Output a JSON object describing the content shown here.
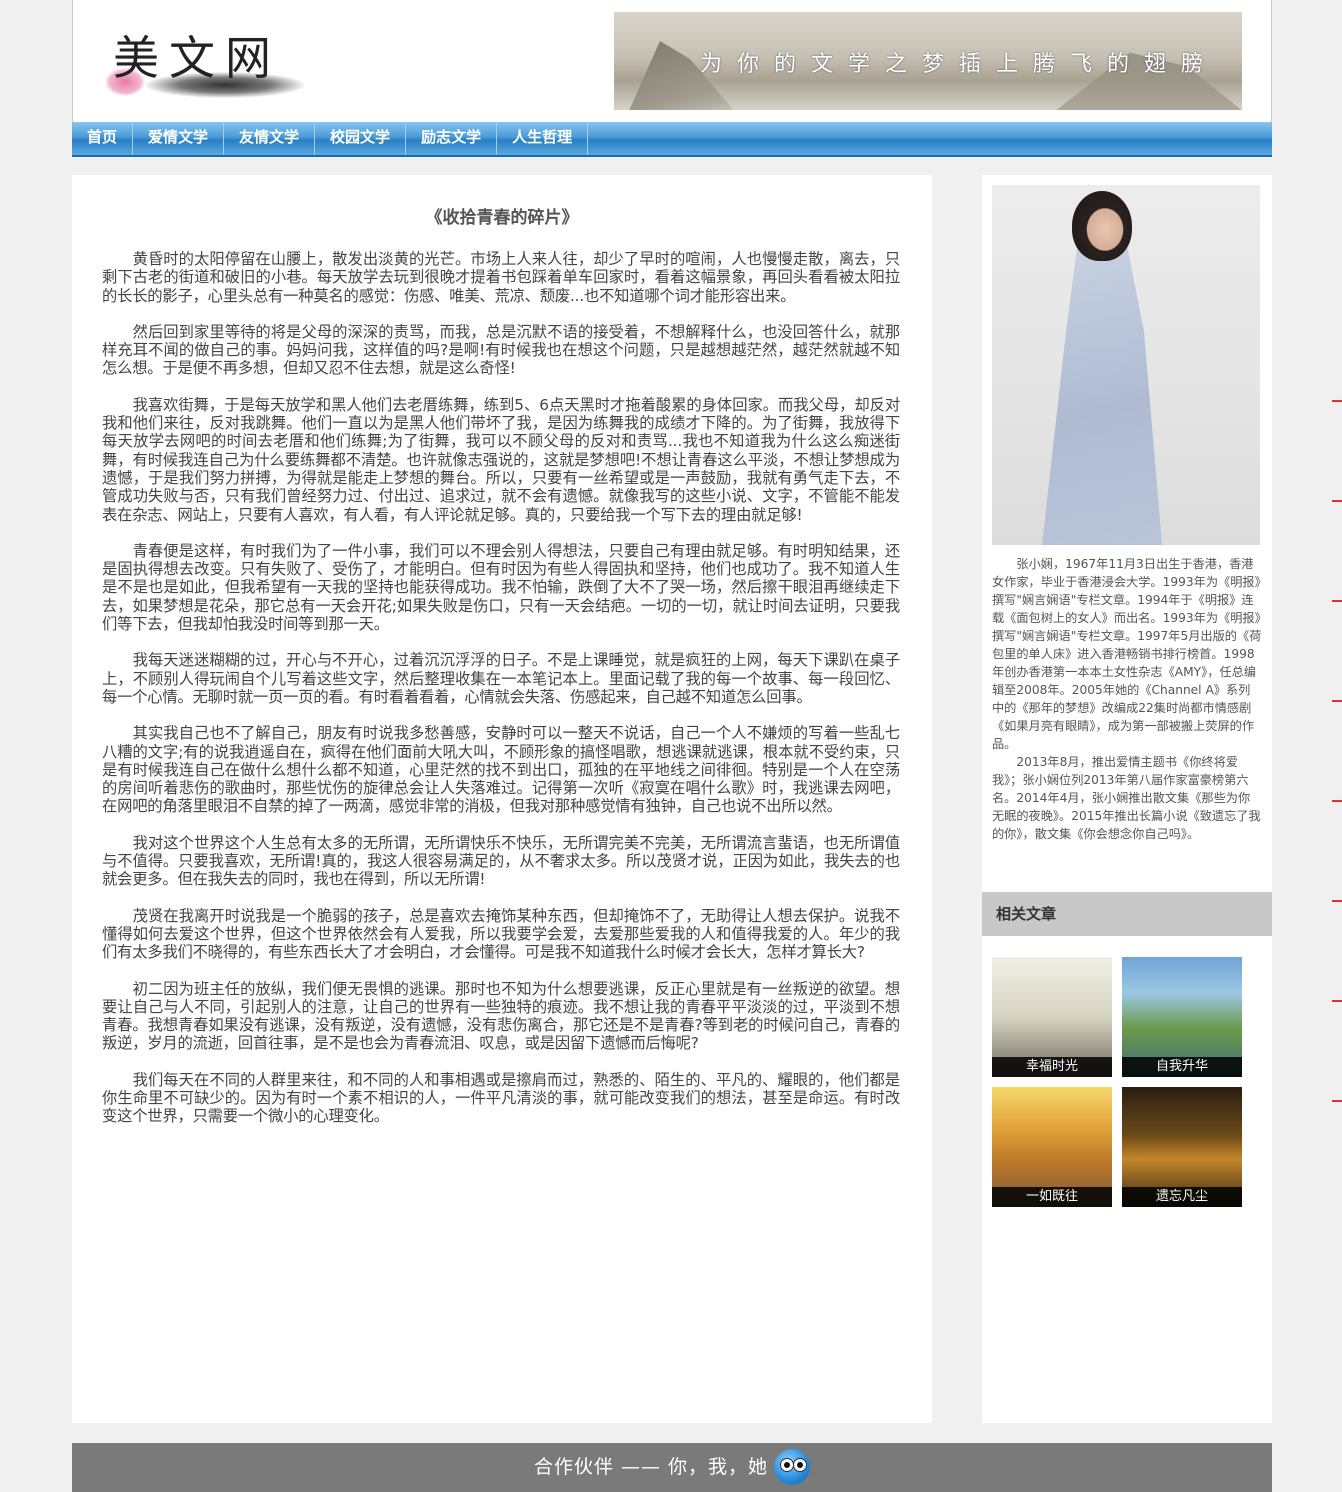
{
  "header": {
    "logo_text": "美文网",
    "banner_slogan": "为你的文学之梦插上腾飞的翅膀"
  },
  "nav": {
    "items": [
      "首页",
      "爱情文学",
      "友情文学",
      "校园文学",
      "励志文学",
      "人生哲理"
    ]
  },
  "article": {
    "title": "《收拾青春的碎片》",
    "paragraphs": [
      "黄昏时的太阳停留在山腰上，散发出淡黄的光芒。市场上人来人往，却少了早时的喧闹，人也慢慢走散，离去，只剩下古老的街道和破旧的小巷。每天放学去玩到很晚才提着书包踩着单车回家时，看着这幅景象，再回头看看被太阳拉的长长的影子，心里头总有一种莫名的感觉：伤感、唯美、荒凉、颓废...也不知道哪个词才能形容出来。",
      "然后回到家里等待的将是父母的深深的责骂，而我，总是沉默不语的接受着，不想解释什么，也没回答什么，就那样充耳不闻的做自己的事。妈妈问我，这样值的吗?是啊!有时候我也在想这个问题，只是越想越茫然，越茫然就越不知怎么想。于是便不再多想，但却又忍不住去想，就是这么奇怪!",
      "我喜欢街舞，于是每天放学和黑人他们去老厝练舞，练到5、6点天黑时才拖着酸累的身体回家。而我父母，却反对我和他们来往，反对我跳舞。他们一直以为是黑人他们带坏了我，是因为练舞我的成绩才下降的。为了街舞，我放得下每天放学去网吧的时间去老厝和他们练舞;为了街舞，我可以不顾父母的反对和责骂...我也不知道我为什么这么痴迷街舞，有时候我连自己为什么要练舞都不清楚。也许就像志强说的，这就是梦想吧!不想让青春这么平淡，不想让梦想成为遗憾，于是我们努力拼搏，为得就是能走上梦想的舞台。所以，只要有一丝希望或是一声鼓励，我就有勇气走下去，不管成功失败与否，只有我们曾经努力过、付出过、追求过，就不会有遗憾。就像我写的这些小说、文字，不管能不能发表在杂志、网站上，只要有人喜欢，有人看，有人评论就足够。真的，只要给我一个写下去的理由就足够!",
      "青春便是这样，有时我们为了一件小事，我们可以不理会别人得想法，只要自己有理由就足够。有时明知结果，还是固执得想去改变。只有失败了、受伤了，才能明白。但有时因为有些人得固执和坚持，他们也成功了。我不知道人生是不是也是如此，但我希望有一天我的坚持也能获得成功。我不怕输，跌倒了大不了哭一场，然后擦干眼泪再继续走下去，如果梦想是花朵，那它总有一天会开花;如果失败是伤口，只有一天会结疤。一切的一切，就让时间去证明，只要我们等下去，但我却怕我没时间等到那一天。",
      "我每天迷迷糊糊的过，开心与不开心，过着沉沉浮浮的日子。不是上课睡觉，就是疯狂的上网，每天下课趴在桌子上，不顾别人得玩闹自个儿写着这些文字，然后整理收集在一本笔记本上。里面记载了我的每一个故事、每一段回忆、每一个心情。无聊时就一页一页的看。有时看着看着，心情就会失落、伤感起来，自己越不知道怎么回事。",
      "其实我自己也不了解自己，朋友有时说我多愁善感，安静时可以一整天不说话，自己一个人不嫌烦的写着一些乱七八糟的文字;有的说我逍遥自在，疯得在他们面前大吼大叫，不顾形象的搞怪唱歌，想逃课就逃课，根本就不受约束，只是有时候我连自己在做什么想什么都不知道，心里茫然的找不到出口，孤独的在平地线之间徘徊。特别是一个人在空荡的房间听着悲伤的歌曲时，那些忧伤的旋律总会让人失落难过。记得第一次听《寂寞在唱什么歌》时，我逃课去网吧，在网吧的角落里眼泪不自禁的掉了一两滴，感觉非常的消极，但我对那种感觉情有独钟，自己也说不出所以然。",
      "我对这个世界这个人生总有太多的无所谓，无所谓快乐不快乐，无所谓完美不完美，无所谓流言蜚语，也无所谓值与不值得。只要我喜欢，无所谓!真的，我这人很容易满足的，从不奢求太多。所以茂贤才说，正因为如此，我失去的也就会更多。但在我失去的同时，我也在得到，所以无所谓!",
      "茂贤在我离开时说我是一个脆弱的孩子，总是喜欢去掩饰某种东西，但却掩饰不了，无助得让人想去保护。说我不懂得如何去爱这个世界，但这个世界依然会有人爱我，所以我要学会爱，去爱那些爱我的人和值得我爱的人。年少的我们有太多我们不晓得的，有些东西长大了才会明白，才会懂得。可是我不知道我什么时候才会长大，怎样才算长大?",
      "初二因为班主任的放纵，我们便无畏惧的逃课。那时也不知为什么想要逃课，反正心里就是有一丝叛逆的欲望。想要让自己与人不同，引起别人的注意，让自己的世界有一些独特的痕迹。我不想让我的青春平平淡淡的过，平淡到不想青春。我想青春如果没有逃课，没有叛逆，没有遗憾，没有悲伤离合，那它还是不是青春?等到老的时候问自己，青春的叛逆，岁月的流逝，回首往事，是不是也会为青春流泪、叹息，或是因留下遗憾而后悔呢?",
      "我们每天在不同的人群里来往，和不同的人和事相遇或是擦肩而过，熟悉的、陌生的、平凡的、耀眼的，他们都是你生命里不可缺少的。因为有时一个素不相识的人，一件平凡清淡的事，就可能改变我们的想法，甚至是命运。有时改变这个世界，只需要一个微小的心理变化。"
    ]
  },
  "sidebar": {
    "bio_paragraphs": [
      "张小娴，1967年11月3日出生于香港，香港女作家，毕业于香港浸会大学。1993年为《明报》撰写\"娴言娴语\"专栏文章。1994年于《明报》连载《面包树上的女人》而出名。1993年为《明报》撰写\"娴言娴语\"专栏文章。1997年5月出版的《荷包里的单人床》进入香港畅销书排行榜首。1998年创办香港第一本本土女性杂志《AMY》，任总编辑至2008年。2005年她的《Channel A》系列中的《那年的梦想》改编成22集时尚都市情感剧《如果月亮有眼睛》，成为第一部被搬上荧屏的作品。",
      "2013年8月，推出爱情主题书《你终将爱我》；张小娴位列2013年第八届作家富豪榜第六名。2014年4月，张小娴推出散文集《那些为你无眠的夜晚》。2015年推出长篇小说《致遗忘了我的你》，散文集《你会想念你自己吗》。"
    ],
    "related_title": "相关文章",
    "related": [
      "幸福时光",
      "自我升华",
      "一如既往",
      "遗忘凡尘"
    ]
  },
  "footer": {
    "text": "合作伙伴 —— 你，我，她"
  }
}
